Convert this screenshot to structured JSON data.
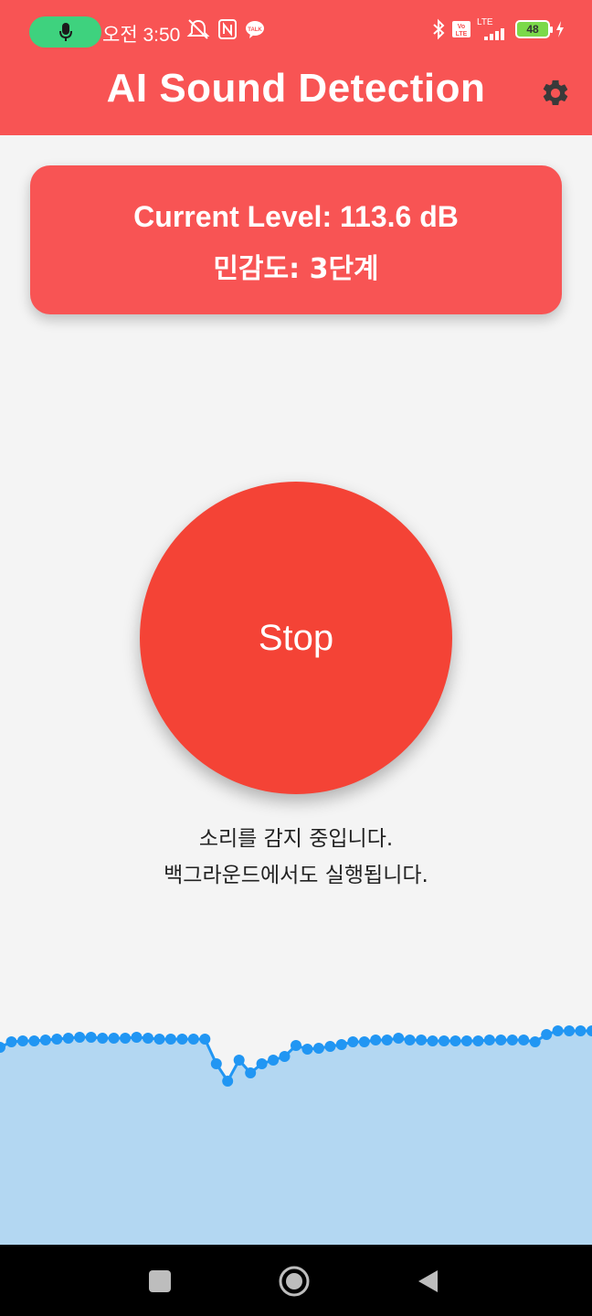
{
  "status_bar": {
    "time": "오전 3:50",
    "lte_label": "LTE",
    "volte_label": "Vo LTE",
    "battery_level": "48"
  },
  "header": {
    "title": "AI Sound Detection"
  },
  "level_card": {
    "current_level": "Current Level: 113.6 dB",
    "sensitivity": "민감도: 3단계"
  },
  "control": {
    "stop_label": "Stop"
  },
  "status": {
    "line1": "소리를 감지 중입니다.",
    "line2": "백그라운드에서도 실행됩니다."
  },
  "colors": {
    "accent": "#f85454",
    "stop_button": "#f44336",
    "wave_line": "#2196f3",
    "wave_fill": "#b3d7f2",
    "background": "#f4f4f4"
  },
  "icons": {
    "settings": "gear-icon",
    "mic": "microphone-icon",
    "nav_recent": "square-icon",
    "nav_home": "circle-icon",
    "nav_back": "triangle-back-icon"
  }
}
